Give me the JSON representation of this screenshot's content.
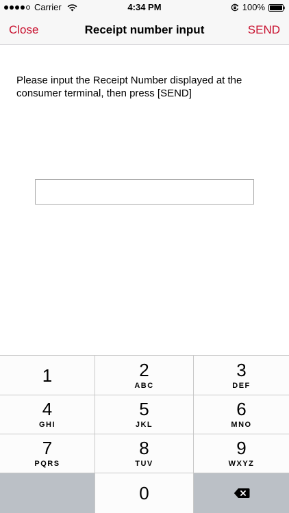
{
  "status_bar": {
    "carrier": "Carrier",
    "time": "4:34 PM",
    "battery_percent": "100%",
    "signal_icon": "signal-dots-icon",
    "wifi_icon": "wifi-icon",
    "rotation_icon": "rotation-lock-icon",
    "battery_icon": "battery-icon"
  },
  "nav": {
    "close_label": "Close",
    "title": "Receipt number input",
    "send_label": "SEND"
  },
  "content": {
    "instructions": "Please input the Receipt Number displayed at the consumer terminal, then press [SEND]",
    "input_value": "",
    "input_placeholder": ""
  },
  "keypad": {
    "keys": [
      {
        "digit": "1",
        "letters": ""
      },
      {
        "digit": "2",
        "letters": "ABC"
      },
      {
        "digit": "3",
        "letters": "DEF"
      },
      {
        "digit": "4",
        "letters": "GHI"
      },
      {
        "digit": "5",
        "letters": "JKL"
      },
      {
        "digit": "6",
        "letters": "MNO"
      },
      {
        "digit": "7",
        "letters": "PQRS"
      },
      {
        "digit": "8",
        "letters": "TUV"
      },
      {
        "digit": "9",
        "letters": "WXYZ"
      },
      {
        "digit": "0",
        "letters": ""
      }
    ],
    "delete_icon": "backspace-icon"
  },
  "colors": {
    "accent": "#c8102e",
    "bar_background": "#f7f7f7",
    "key_background": "#fcfcfc",
    "key_dark_background": "#bbc0c6"
  }
}
